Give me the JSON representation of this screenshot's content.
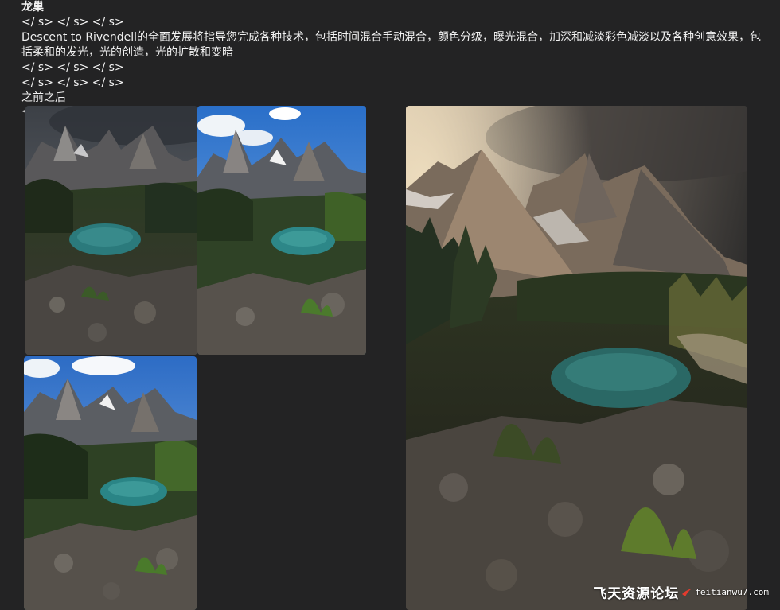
{
  "post": {
    "title": "龙巢",
    "tags_line_1": "</ s> </ s> </ s>",
    "description": "Descent to Rivendell的全面发展将指导您完成各种技术，包括时间混合手动混合，颜色分级，曝光混合，加深和减淡彩色减淡以及各种创意效果，包括柔和的发光，光的创造，光的扩散和变暗",
    "tags_line_2": "</ s> </ s> </ s>",
    "tags_line_3": "</ s> </ s> </ s>",
    "before_after": "之前之后",
    "cut_marker": "<"
  },
  "images": {
    "raw_exposure_dark": {
      "alt": "mountain lake raw exposure - dark sky"
    },
    "raw_exposure_blue": {
      "alt": "mountain lake raw exposure - blue sky"
    },
    "raw_exposure_third": {
      "alt": "mountain lake raw exposure - bright"
    },
    "final_edit": {
      "alt": "mountain lake final edited image"
    }
  },
  "watermark": {
    "site_cn": "飞天资源论坛",
    "site_url": "feitianwu7.com",
    "icon": "swoosh-icon"
  },
  "colors": {
    "background": "#232324",
    "text": "#f2f2f2",
    "watermark_accent": "#e23b2e"
  }
}
